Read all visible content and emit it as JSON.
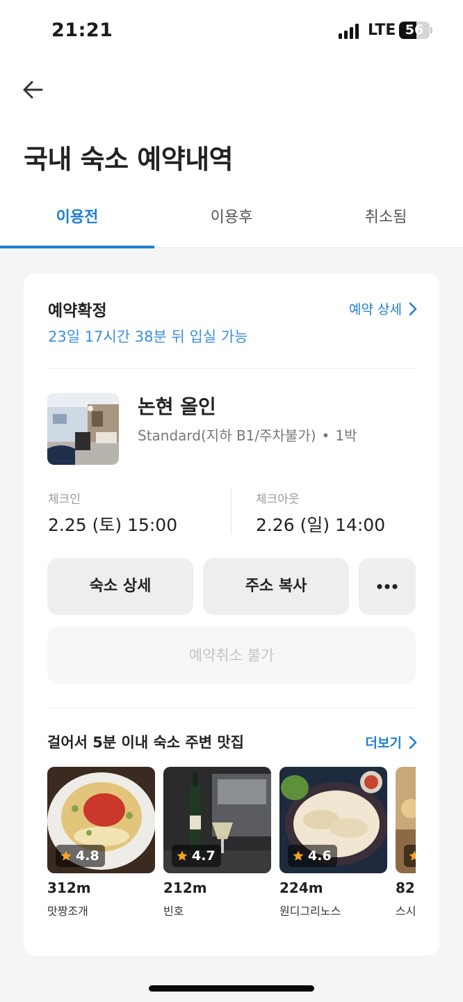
{
  "status_bar": {
    "time": "21:21",
    "network": "LTE",
    "battery": "56",
    "battery_level": 0.56
  },
  "header": {
    "back_icon": "arrow-left-icon",
    "title": "국내 숙소 예약내역"
  },
  "tabs": [
    {
      "label": "이용전",
      "active": true
    },
    {
      "label": "이용후",
      "active": false
    },
    {
      "label": "취소됨",
      "active": false
    }
  ],
  "reservation": {
    "status": "예약확정",
    "detail_link": "예약 상세",
    "checkin_remaining": "23일 17시간 38분 뒤 입실 가능",
    "hotel_name": "논현 올인",
    "room_type": "Standard(지하 B1/주차불가)",
    "separator": "•",
    "nights": "1박",
    "checkin_label": "체크인",
    "checkin_value": "2.25 (토) 15:00",
    "checkout_label": "체크아웃",
    "checkout_value": "2.26 (일) 14:00",
    "buttons": {
      "hotel_detail": "숙소 상세",
      "copy_address": "주소 복사",
      "more_icon": "more-horizontal-icon"
    },
    "cancel_button": "예약취소 불가"
  },
  "nearby": {
    "title": "걸어서 5분 이내 숙소 주변 맛집",
    "more_link": "더보기",
    "restaurants": [
      {
        "rating": "4.8",
        "distance": "312m",
        "name": "맛짱조개"
      },
      {
        "rating": "4.7",
        "distance": "212m",
        "name": "빈호"
      },
      {
        "rating": "4.6",
        "distance": "224m",
        "name": "원디그리노스"
      },
      {
        "rating": "",
        "distance": "82",
        "name": "스시"
      }
    ]
  },
  "colors": {
    "accent": "#1d7fd4",
    "star": "#f5a623",
    "background": "#f4f5f7"
  }
}
